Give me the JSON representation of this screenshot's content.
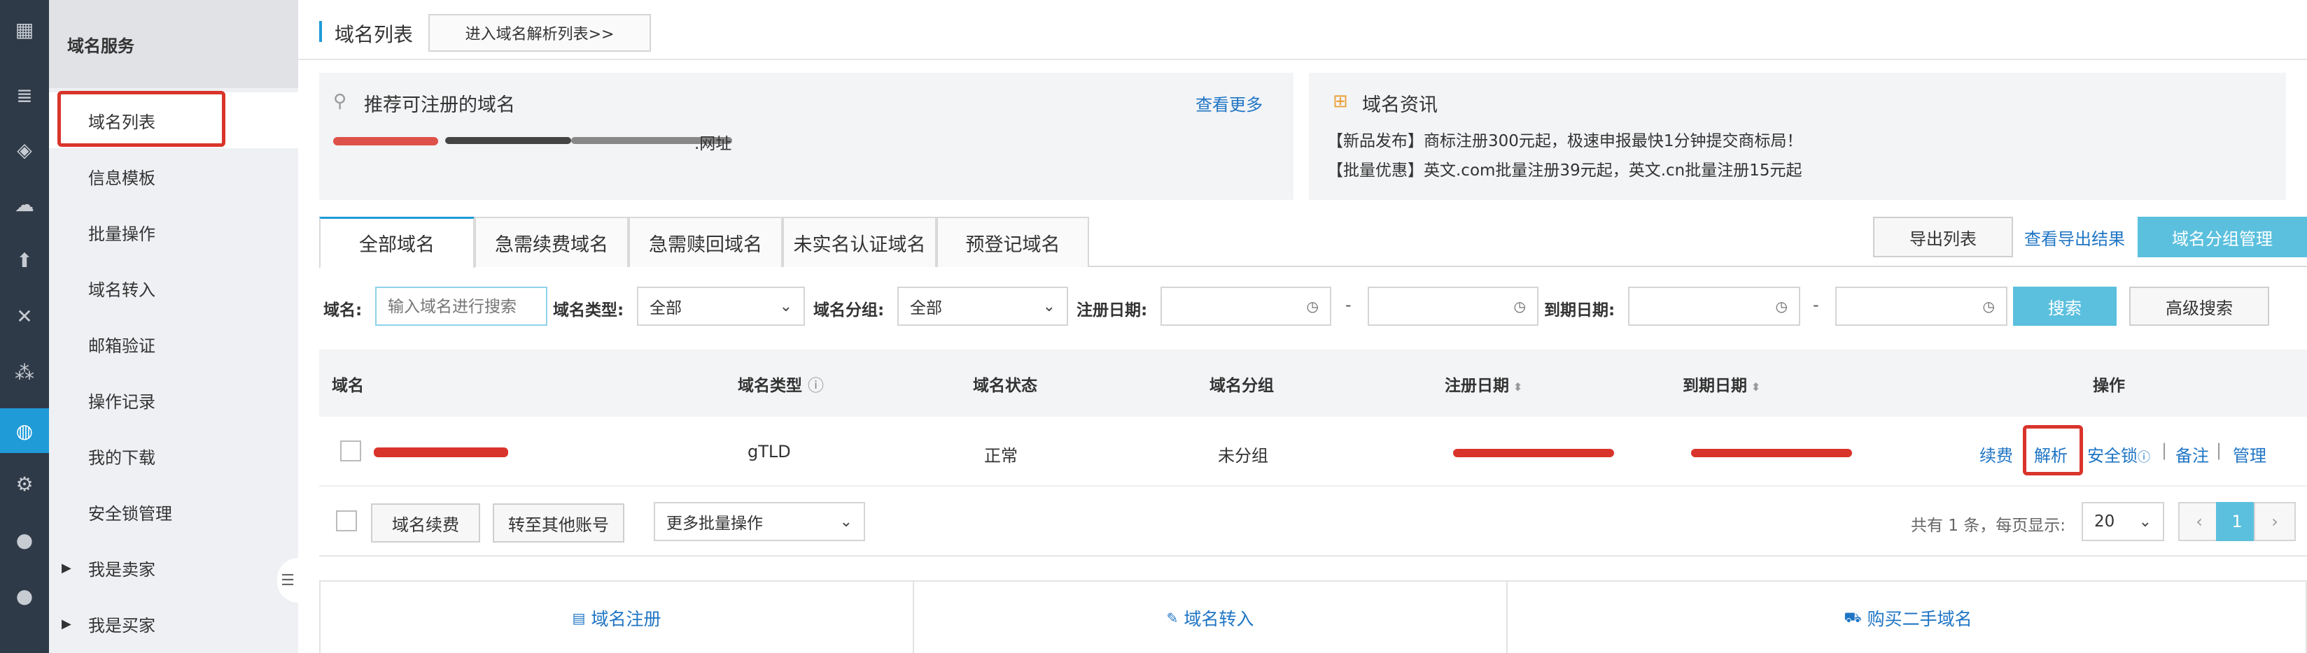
{
  "rail": {
    "icons": [
      "apps-grid-icon",
      "server-icon",
      "cube-icon",
      "cloud-icon",
      "cloud-upload-icon",
      "network-icon",
      "cluster-icon",
      "globe-icon",
      "devops-icon",
      "circle-icon",
      "circle-icon"
    ]
  },
  "sidebar": {
    "title": "域名服务",
    "items": [
      {
        "label": "域名列表",
        "active": true
      },
      {
        "label": "信息模板"
      },
      {
        "label": "批量操作"
      },
      {
        "label": "域名转入"
      },
      {
        "label": "邮箱验证"
      },
      {
        "label": "操作记录"
      },
      {
        "label": "我的下载"
      },
      {
        "label": "安全锁管理"
      },
      {
        "label": "我是卖家",
        "expandable": true
      },
      {
        "label": "我是买家",
        "expandable": true
      }
    ],
    "toggle_icon": "collapse-icon"
  },
  "topbar": {
    "title": "域名列表",
    "dns_button": "进入域名解析列表>>"
  },
  "recommend": {
    "title": "推荐可注册的域名",
    "more": "查看更多",
    "domains_partial": ".网址"
  },
  "news": {
    "title": "域名资讯",
    "line1": "【新品发布】商标注册300元起，极速申报最快1分钟提交商标局！",
    "line2": "【批量优惠】英文.com批量注册39元起，英文.cn批量注册15元起"
  },
  "tabs": [
    "全部域名",
    "急需续费域名",
    "急需赎回域名",
    "未实名认证域名",
    "预登记域名"
  ],
  "actions": {
    "export": "导出列表",
    "view_export": "查看导出结果",
    "group_manage": "域名分组管理"
  },
  "filters": {
    "domain_label": "域名:",
    "domain_placeholder": "输入域名进行搜索",
    "type_label": "域名类型:",
    "type_value": "全部",
    "group_label": "域名分组:",
    "group_value": "全部",
    "reg_date_label": "注册日期:",
    "exp_date_label": "到期日期:",
    "dash": "-",
    "search": "搜索",
    "advanced": "高级搜索"
  },
  "table": {
    "headers": {
      "domain": "域名",
      "type": "域名类型",
      "status": "域名状态",
      "group": "域名分组",
      "reg_date": "注册日期",
      "exp_date": "到期日期",
      "ops": "操作"
    },
    "rows": [
      {
        "type": "gTLD",
        "status": "正常",
        "group": "未分组",
        "ops": {
          "renew": "续费",
          "resolve": "解析",
          "lock": "安全锁",
          "note": "备注",
          "manage": "管理"
        }
      }
    ]
  },
  "bulk": {
    "renew": "域名续费",
    "transfer": "转至其他账号",
    "more": "更多批量操作",
    "summary": "共有 1 条，每页显示:",
    "page_size": "20",
    "prev": "‹",
    "page": "1",
    "next": "›"
  },
  "footer": {
    "register": "域名注册",
    "transfer_in": "域名转入",
    "buy_second": "购买二手域名"
  },
  "colors": {
    "accent": "#1f9bd8",
    "link": "#1f75c4",
    "primary_btn": "#5bc0de",
    "annotation": "#d9342b"
  }
}
